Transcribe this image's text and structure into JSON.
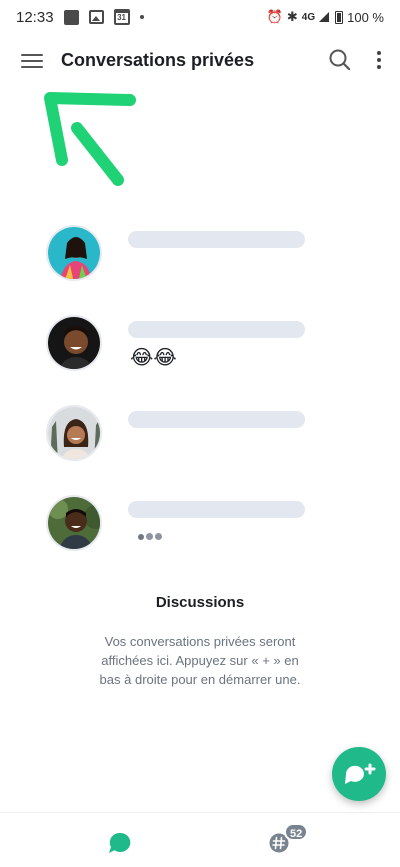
{
  "status_bar": {
    "time": "12:33",
    "calendar_day": "31",
    "network": "4G",
    "battery": "100 %"
  },
  "app_bar": {
    "title": "Conversations privées",
    "icons": [
      "menu-icon",
      "search-icon",
      "more-vertical-icon"
    ]
  },
  "placeholder_rows": [
    {
      "avatar": "avatar-woman-colorful-dress",
      "preview": ""
    },
    {
      "avatar": "avatar-man-smiling",
      "preview": "😂😂"
    },
    {
      "avatar": "avatar-woman-palm-trees",
      "preview": ""
    },
    {
      "avatar": "avatar-man-green-background",
      "preview": "typing-dots"
    }
  ],
  "empty_state": {
    "title": "Discussions",
    "text": "Vos conversations privées seront affichées ici. Appuyez sur « + » en bas à droite pour en démarrer une."
  },
  "fab": {
    "icon": "new-chat-plus-icon"
  },
  "bottom_nav": {
    "items": [
      "chat-bubble-icon",
      "hashtag-channels-icon"
    ],
    "channels_badge": "52"
  },
  "colors": {
    "accent_green": "#1fb98a",
    "annotation_green": "#1ed275",
    "placeholder_bar": "#e3e7ef",
    "badge_gray": "#7a8390"
  }
}
